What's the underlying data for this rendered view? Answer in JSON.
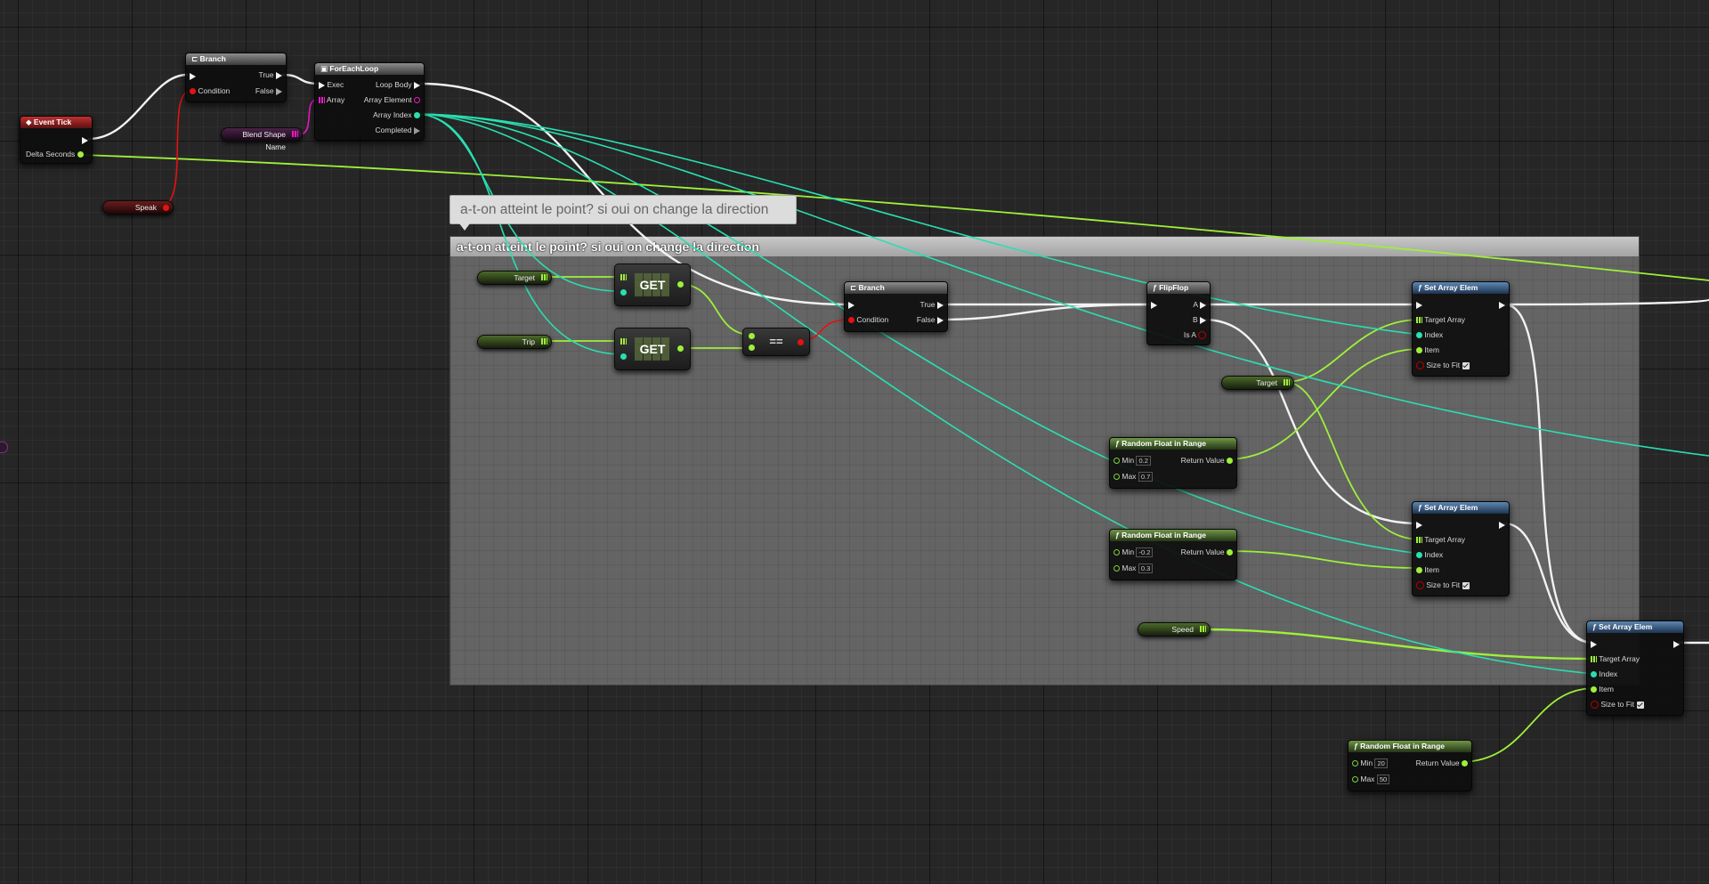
{
  "comment": {
    "bubble_text": "a-t-on atteint le point? si oui on change la direction",
    "header_text": "a-t-on atteint le point? si oui on change la direction"
  },
  "event_tick": {
    "title": "Event Tick",
    "delta_seconds": "Delta Seconds"
  },
  "branch1": {
    "title": "Branch",
    "true_label": "True",
    "false_label": "False",
    "condition_label": "Condition"
  },
  "foreach": {
    "title": "ForEachLoop",
    "exec": "Exec",
    "array": "Array",
    "loop_body": "Loop Body",
    "array_element": "Array Element",
    "array_index": "Array Index",
    "completed": "Completed"
  },
  "variables": {
    "blend_shape_name": "Blend Shape Name",
    "speak": "Speak",
    "target1": "Target",
    "trip": "Trip",
    "target2": "Target",
    "speed": "Speed"
  },
  "get_label": "GET",
  "equals_label": "==",
  "branch2": {
    "title": "Branch",
    "true_label": "True",
    "false_label": "False",
    "condition_label": "Condition"
  },
  "flipflop": {
    "title": "FlipFlop",
    "a": "A",
    "b": "B",
    "is_a": "Is A"
  },
  "set_array": {
    "title": "Set Array Elem",
    "target_array": "Target Array",
    "index": "Index",
    "item": "Item",
    "size_to_fit": "Size to Fit"
  },
  "random1": {
    "title": "Random Float in Range",
    "min_label": "Min",
    "min_value": "0.2",
    "max_label": "Max",
    "max_value": "0.7",
    "return_value": "Return Value"
  },
  "random2": {
    "title": "Random Float in Range",
    "min_label": "Min",
    "min_value": "-0.2",
    "max_label": "Max",
    "max_value": "0.3",
    "return_value": "Return Value"
  },
  "random3": {
    "title": "Random Float in Range",
    "min_label": "Min",
    "min_value": "20",
    "max_label": "Max",
    "max_value": "50",
    "return_value": "Return Value"
  },
  "colors": {
    "exec_wire": "#f2f2f2",
    "float_wire": "#9ef03a",
    "int_wire": "#29dfb0",
    "bool_wire": "#e41212",
    "name_wire": "#f018c8"
  }
}
